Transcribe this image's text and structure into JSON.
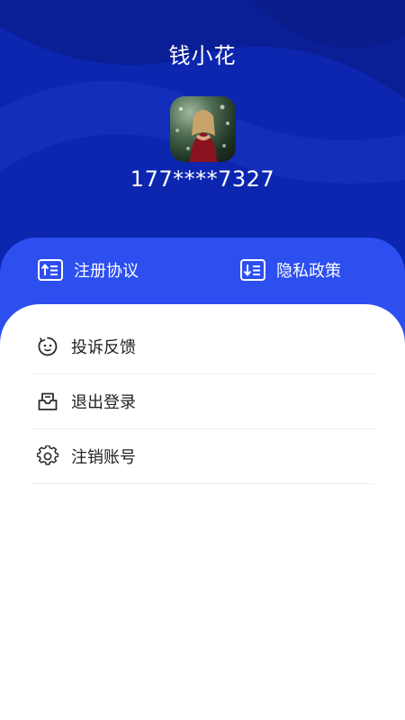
{
  "profile": {
    "name": "钱小花",
    "phone": "177****7327"
  },
  "links": [
    {
      "label": "注册协议",
      "icon": "upload-list-icon"
    },
    {
      "label": "隐私政策",
      "icon": "download-list-icon"
    }
  ],
  "menu": [
    {
      "label": "投诉反馈",
      "icon": "face-smile-icon"
    },
    {
      "label": "退出登录",
      "icon": "mailbox-logout-icon"
    },
    {
      "label": "注销账号",
      "icon": "gear-icon"
    }
  ],
  "colors": {
    "header_bg": "#0d26b0",
    "card_bg": "#2d4ff0",
    "sheet_bg": "#ffffff"
  }
}
